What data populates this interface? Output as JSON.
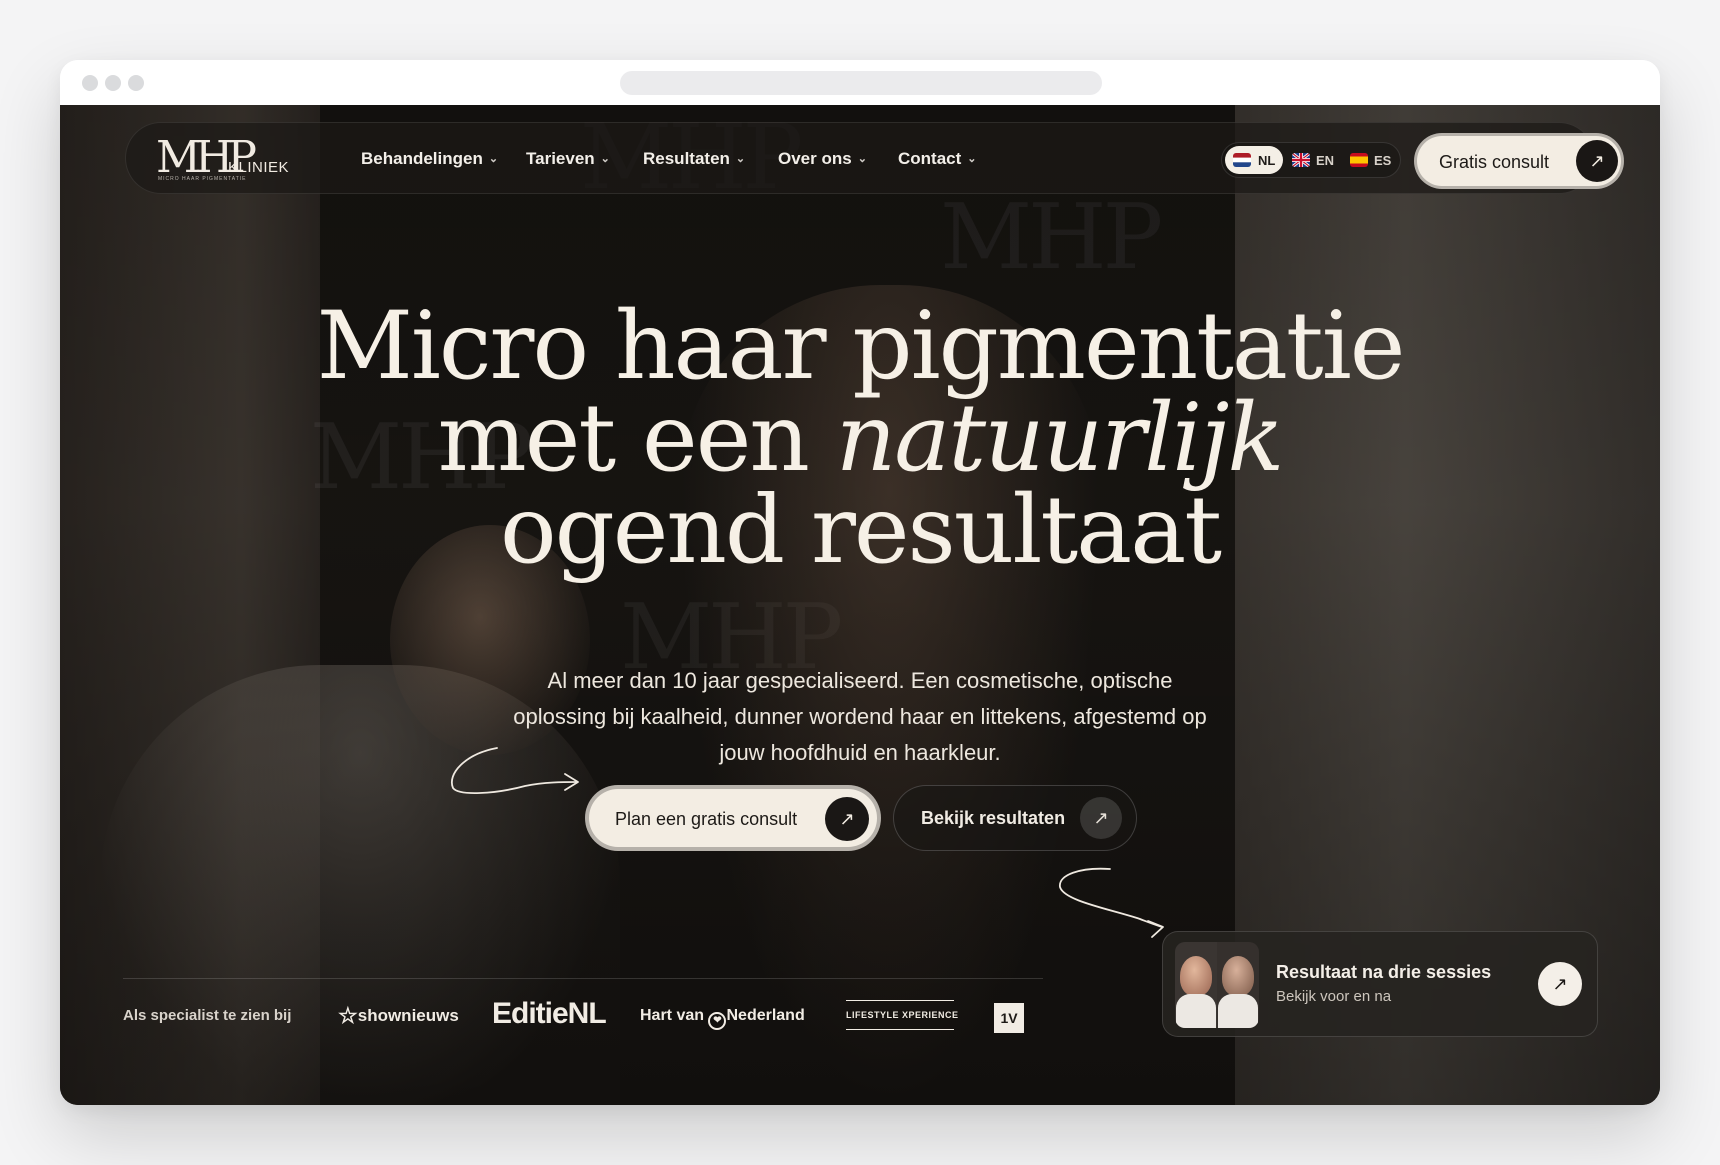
{
  "nav": {
    "logo_text": "MHP",
    "logo_word": "KLINIEK",
    "logo_tagline": "MICRO HAAR PIGMENTATIE",
    "items": [
      {
        "label": "Behandelingen"
      },
      {
        "label": "Tarieven"
      },
      {
        "label": "Resultaten"
      },
      {
        "label": "Over ons"
      },
      {
        "label": "Contact"
      }
    ],
    "languages": [
      {
        "code": "NL",
        "active": true,
        "flag": "netherlands-flag"
      },
      {
        "code": "EN",
        "active": false,
        "flag": "uk-flag"
      },
      {
        "code": "ES",
        "active": false,
        "flag": "spain-flag"
      }
    ],
    "cta_label": "Gratis consult",
    "cta_icon": "arrow-up-right-icon"
  },
  "hero": {
    "headline_line1": "Micro haar pigmentatie",
    "headline_line2_prefix": "met een ",
    "headline_line2_italic": "natuurlijk",
    "headline_line3": "ogend resultaat",
    "subtext": "Al meer dan 10 jaar gespecialiseerd. Een cosmetische, optische oplossing bij kaalheid, dunner wordend haar en littekens, afgestemd op jouw hoofdhuid en haarkleur.",
    "primary_button": "Plan een gratis consult",
    "secondary_button": "Bekijk resultaten"
  },
  "press": {
    "label": "Als specialist te zien bij",
    "logos": [
      {
        "name": "shownieuws",
        "text": "shownieuws"
      },
      {
        "name": "editienl",
        "text": "EditieNL"
      },
      {
        "name": "hart-van-nederland",
        "text_prefix": "Hart van",
        "text_suffix": "Nederland"
      },
      {
        "name": "lifestyle-xperience",
        "text": "LIFESTYLE XPERIENCE"
      },
      {
        "name": "1v",
        "text": "1V"
      }
    ]
  },
  "result_card": {
    "title": "Resultaat na drie sessies",
    "subtitle": "Bekijk voor en na"
  },
  "colors": {
    "cream": "#f3ede3",
    "dark": "#1a1715"
  }
}
